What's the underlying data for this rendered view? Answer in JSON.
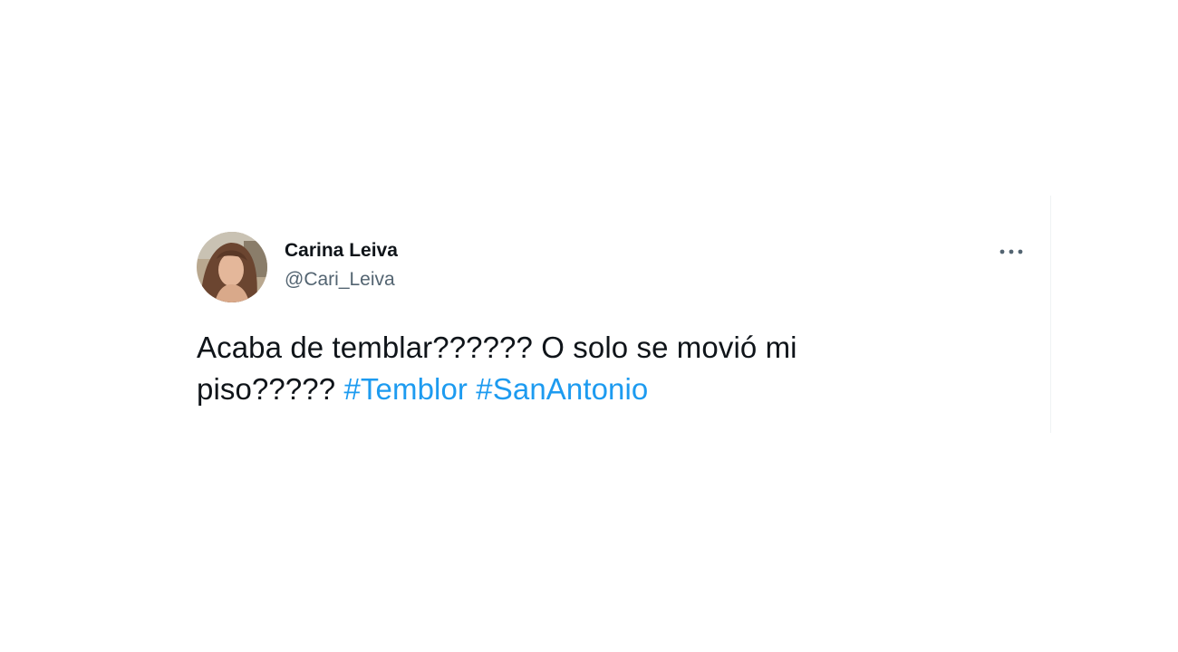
{
  "tweet": {
    "author": {
      "display_name": "Carina Leiva",
      "handle": "@Cari_Leiva",
      "avatar_icon": "profile-photo"
    },
    "more_icon": "more-horizontal-icon",
    "text_part1": "Acaba de temblar?????? O solo se movió mi piso?????",
    "hashtags": [
      "#Temblor",
      "#SanAntonio"
    ]
  },
  "colors": {
    "text": "#0f1419",
    "secondary_text": "#536471",
    "link": "#1d9bf0",
    "background": "#ffffff"
  }
}
